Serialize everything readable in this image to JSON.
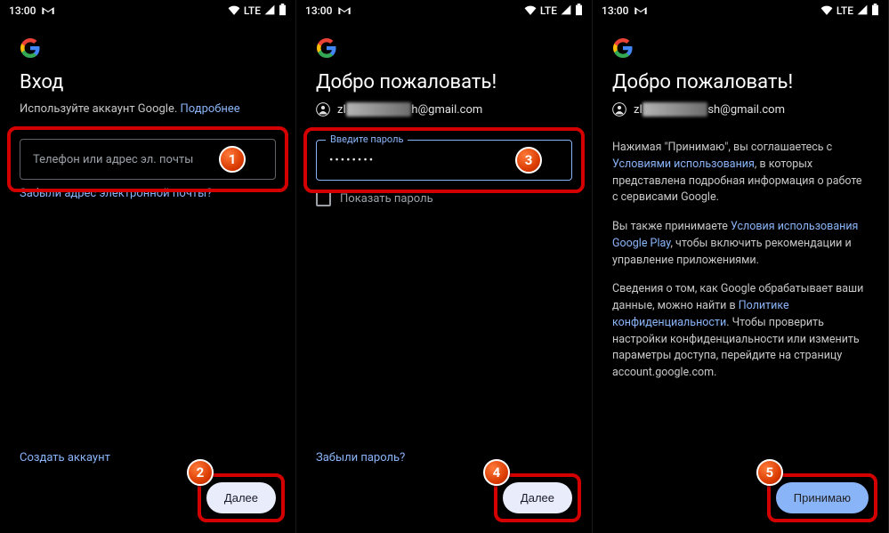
{
  "status": {
    "time": "13:00",
    "network": "LTE"
  },
  "screen1": {
    "title": "Вход",
    "subtitle_prefix": "Используйте аккаунт Google. ",
    "subtitle_link": "Подробнее",
    "input_placeholder": "Телефон или адрес эл. почты",
    "forgot_email": "Забыли адрес электронной почты?",
    "create_account": "Создать аккаунт",
    "next": "Далее",
    "badge_input": "1",
    "badge_next": "2"
  },
  "screen2": {
    "title": "Добро пожаловать!",
    "email_prefix": "zl",
    "email_redacted": "████████",
    "email_suffix": "h@gmail.com",
    "password_label": "Введите пароль",
    "password_dots": "••••••••",
    "show_password": "Показать пароль",
    "forgot_password": "Забыли пароль?",
    "next": "Далее",
    "badge_input": "3",
    "badge_next": "4"
  },
  "screen3": {
    "title": "Добро пожаловать!",
    "email_prefix": "zl",
    "email_redacted": "████████",
    "email_suffix": "sh@gmail.com",
    "p1_prefix": "Нажимая \"Принимаю\", вы соглашаетесь с ",
    "p1_link": "Условиями использования",
    "p1_suffix": ", в которых представлена подробная информация о работе с сервисами Google.",
    "p2_prefix": "Вы также принимаете ",
    "p2_link": "Условия использования Google Play",
    "p2_suffix": ", чтобы включить рекомендации и управление приложениями.",
    "p3_prefix": "Сведения о том, как Google обрабатывает ваши данные, можно найти в ",
    "p3_link": "Политике конфиденциальности",
    "p3_suffix": ". Чтобы проверить настройки конфиденциальности или изменить параметры доступа, перейдите на страницу account.google.com.",
    "accept": "Принимаю",
    "badge_accept": "5"
  }
}
